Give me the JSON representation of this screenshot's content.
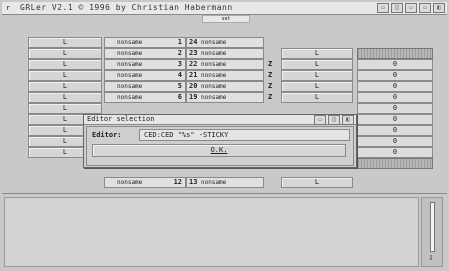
{
  "window": {
    "title": "GRLer V2.1  © 1996 by Christian Habermann",
    "sys_icon": "r",
    "buttons": [
      "depth",
      "zoom",
      "min",
      "max",
      "close"
    ]
  },
  "panel": {
    "header_tab": "set"
  },
  "rows": [
    {
      "left_button": "L",
      "name_label": "nonsame",
      "num": "1",
      "val_num": "24",
      "val_label": "nonsame",
      "z": "",
      "right_button": ""
    },
    {
      "left_button": "L",
      "name_label": "nonsame",
      "num": "2",
      "val_num": "23",
      "val_label": "nonsame",
      "z": "",
      "right_button": "L"
    },
    {
      "left_button": "L",
      "name_label": "nonsame",
      "num": "3",
      "val_num": "22",
      "val_label": "nonsame",
      "z": "Z",
      "right_button": "L"
    },
    {
      "left_button": "L",
      "name_label": "nonsame",
      "num": "4",
      "val_num": "21",
      "val_label": "nonsame",
      "z": "Z",
      "right_button": "L"
    },
    {
      "left_button": "L",
      "name_label": "nonsame",
      "num": "5",
      "val_num": "20",
      "val_label": "nonsame",
      "z": "Z",
      "right_button": "L"
    },
    {
      "left_button": "L",
      "name_label": "nonsame",
      "num": "6",
      "val_num": "19",
      "val_label": "nonsame",
      "z": "Z",
      "right_button": "L"
    }
  ],
  "hidden_rows_left": [
    "L",
    "L",
    "L",
    "L",
    "L"
  ],
  "last_row": {
    "left_button": "L",
    "name_label": "nonsame",
    "num": "12",
    "val_num": "13",
    "val_label": "nonsame",
    "right_button": "L"
  },
  "right_column": [
    "0",
    "0",
    "0",
    "0",
    "0",
    "0",
    "0",
    "0",
    "0"
  ],
  "dialog": {
    "title": "Editor selection",
    "label": "Editor:",
    "value": "CED:CED \"%s\" -STICKY",
    "ok_label": "O.K."
  },
  "icons": {
    "scroll_down": "down-arrow-icon"
  }
}
